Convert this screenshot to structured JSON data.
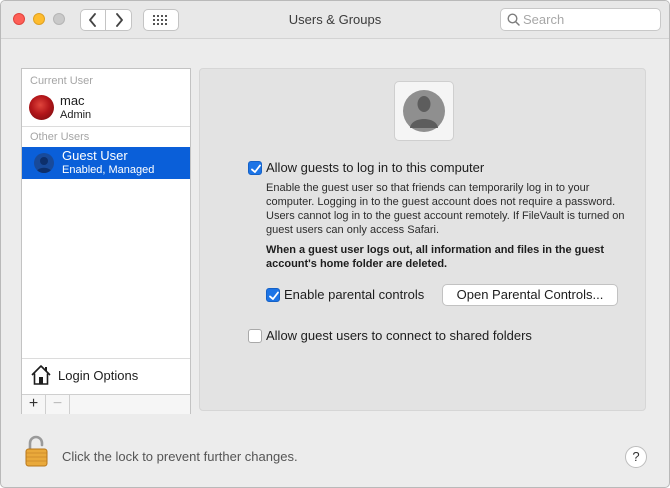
{
  "window": {
    "title": "Users & Groups"
  },
  "toolbar": {
    "back_icon": "chevron-left-icon",
    "forward_icon": "chevron-right-icon",
    "show_all_icon": "grid-icon",
    "search_placeholder": "Search"
  },
  "sidebar": {
    "current_user_label": "Current User",
    "current_user": {
      "name": "mac",
      "role": "Admin",
      "avatar": "rose-avatar"
    },
    "other_users_label": "Other Users",
    "other_users": [
      {
        "name": "Guest User",
        "status": "Enabled, Managed",
        "selected": true,
        "avatar": "person-silhouette"
      }
    ],
    "login_options_label": "Login Options",
    "add_label": "+",
    "remove_label": "−"
  },
  "detail": {
    "allow_guests": {
      "label": "Allow guests to log in to this computer",
      "checked": true
    },
    "description": "Enable the guest user so that friends can temporarily log in to your computer. Logging in to the guest account does not require a password. Users cannot log in to the guest account remotely. If FileVault is turned on guest users can only access Safari.",
    "warning": "When a guest user logs out, all information and files in the guest account's home folder are deleted.",
    "parental_controls": {
      "label": "Enable parental controls",
      "checked": true
    },
    "open_parental_controls_label": "Open Parental Controls...",
    "shared_folders": {
      "label": "Allow guest users to connect to shared folders",
      "checked": false
    }
  },
  "footer": {
    "lock_text": "Click the lock to prevent further changes.",
    "help_label": "?"
  },
  "colors": {
    "selection": "#0a5fd9",
    "checkbox_on": "#1c74e6",
    "close": "#fe5f57",
    "minimize": "#febc2e"
  }
}
